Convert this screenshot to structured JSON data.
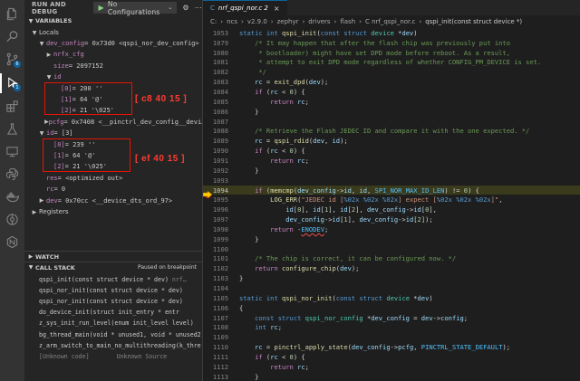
{
  "activity": {
    "icons": [
      "files-icon",
      "search-icon",
      "source-control-icon",
      "run-debug-icon",
      "extensions-icon",
      "testing-icon",
      "remote-explorer-icon",
      "python-icon",
      "docker-icon",
      "gitlens-icon",
      "nordic-icon"
    ],
    "run_badge": "1"
  },
  "sidebar": {
    "header": "RUN AND DEBUG",
    "config": "No Configurations",
    "variables_section": "VARIABLES",
    "locals_label": "Locals",
    "registers_label": "Registers",
    "watch_section": "WATCH",
    "callstack_section": "CALL STACK",
    "callstack_status": "Paused on breakpoint",
    "annotation_1": "[ c8 40 15 ]",
    "annotation_2": "[ ef 40 15 ]",
    "vars": [
      {
        "indent": 1,
        "twisty": "open",
        "name": "dev_config",
        "value": "= 0x73d0 <qspi_nor_dev_config>"
      },
      {
        "indent": 2,
        "twisty": "closed",
        "name": "nrfx_cfg",
        "value": ""
      },
      {
        "indent": 2,
        "twisty": "",
        "name": "size",
        "value": "= 2097152"
      },
      {
        "indent": 2,
        "twisty": "open",
        "name": "id",
        "value": ""
      },
      {
        "indent": 3,
        "twisty": "",
        "name": "[0]",
        "value": "= 200 ''"
      },
      {
        "indent": 3,
        "twisty": "",
        "name": "[1]",
        "value": "= 64 '@'"
      },
      {
        "indent": 3,
        "twisty": "",
        "name": "[2]",
        "value": "= 21 '\\025'"
      },
      {
        "indent": 2,
        "twisty": "closed",
        "name": "pcfg",
        "value": "= 0x7408 <__pinctrl_dev_config__devi…"
      },
      {
        "indent": 1,
        "twisty": "open",
        "name": "id",
        "value": "= [3]"
      },
      {
        "indent": 2,
        "twisty": "",
        "name": "[0]",
        "value": "= 239 ''"
      },
      {
        "indent": 2,
        "twisty": "",
        "name": "[1]",
        "value": "= 64 '@'"
      },
      {
        "indent": 2,
        "twisty": "",
        "name": "[2]",
        "value": "= 21 '\\025'"
      },
      {
        "indent": 1,
        "twisty": "",
        "name": "res",
        "value": "= <optimized out>"
      },
      {
        "indent": 1,
        "twisty": "",
        "name": "rc",
        "value": "= 0"
      },
      {
        "indent": 1,
        "twisty": "closed",
        "name": "dev",
        "value": "= 0x70cc <__device_dts_ord_97>"
      }
    ],
    "callstack": [
      {
        "fn": "qspi_init(const struct device * dev)",
        "src": "nrf…"
      },
      {
        "fn": "qspi_nor_init(const struct device * dev)",
        "src": ""
      },
      {
        "fn": "qspi_nor_init(const struct device * dev)",
        "src": ""
      },
      {
        "fn": "do_device_init(struct init_entry * entr",
        "src": ""
      },
      {
        "fn": "z_sys_init_run_level(enum init_level level)",
        "src": ""
      },
      {
        "fn": "bg_thread_main(void * unused1, void * unused2",
        "src": ""
      },
      {
        "fn": "z_arm_switch_to_main_no_multithreading(k_thre",
        "src": ""
      },
      {
        "fn": "[Unknown code]",
        "src": "Unknown Source"
      }
    ]
  },
  "editor": {
    "tab_label": "nrf_qspi_nor.c 2",
    "breadcrumbs": [
      "C:",
      "ncs",
      "v2.9.0",
      "zephyr",
      "drivers",
      "flash",
      "C  nrf_qspi_nor.c",
      "qspi_init(const struct device *)"
    ],
    "current_line": "1094",
    "lines": [
      {
        "n": "1053",
        "html": "<span class='kw'>static</span> <span class='kw'>int</span> <span class='fn'>qspi_init</span>(<span class='kw'>const</span> <span class='kw'>struct</span> <span class='ty'>device</span> *<span class='va'>dev</span>)"
      },
      {
        "n": "1079",
        "html": "    <span class='cm'>/* It may happen that after the flash chip was previously put into</span>"
      },
      {
        "n": "1080",
        "html": "    <span class='cm'> * bootloader) might have set DPD mode before reboot. As a result,</span>"
      },
      {
        "n": "1081",
        "html": "    <span class='cm'> * attempt to exit DPD mode regardless of whether CONFIG_PM_DEVICE is set.</span>"
      },
      {
        "n": "1082",
        "html": "    <span class='cm'> */</span>"
      },
      {
        "n": "1083",
        "html": "    <span class='va'>rc</span> = <span class='fn'>exit_dpd</span>(<span class='va'>dev</span>);"
      },
      {
        "n": "1084",
        "html": "    <span class='kw2'>if</span> (<span class='va'>rc</span> &lt; <span class='nu'>0</span>) {"
      },
      {
        "n": "1085",
        "html": "        <span class='kw2'>return</span> <span class='va'>rc</span>;"
      },
      {
        "n": "1086",
        "html": "    }"
      },
      {
        "n": "1087",
        "html": ""
      },
      {
        "n": "1088",
        "html": "    <span class='cm'>/* Retrieve the Flash JEDEC ID and compare it with the one expected. */</span>"
      },
      {
        "n": "1089",
        "html": "    <span class='va'>rc</span> = <span class='fn'>qspi_rdid</span>(<span class='va'>dev</span>, <span class='va'>id</span>);"
      },
      {
        "n": "1090",
        "html": "    <span class='kw2'>if</span> (<span class='va'>rc</span> &lt; <span class='nu'>0</span>) {"
      },
      {
        "n": "1091",
        "html": "        <span class='kw2'>return</span> <span class='va'>rc</span>;"
      },
      {
        "n": "1092",
        "html": "    }"
      },
      {
        "n": "1093",
        "html": ""
      },
      {
        "n": "1094",
        "html": "    <span class='kw2'>if</span> (<span class='fn'>memcmp</span>(<span class='va'>dev_config</span>-&gt;<span class='va'>id</span>, <span class='va'>id</span>, <span class='ma'>SPI_NOR_MAX_ID_LEN</span>) != <span class='nu'>0</span>) {"
      },
      {
        "n": "1095",
        "html": "        <span class='fn'>LOG_ERR</span>(<span class='st'>\"JEDEC id [</span><span class='fmt'>%02x %02x %02x</span><span class='st'>] expect [</span><span class='fmt'>%02x %02x %02x</span><span class='st'>]\"</span>,"
      },
      {
        "n": "1096",
        "html": "            <span class='va'>id</span>[<span class='nu'>0</span>], <span class='va'>id</span>[<span class='nu'>1</span>], <span class='va'>id</span>[<span class='nu'>2</span>], <span class='va'>dev_config</span>-&gt;<span class='va'>id</span>[<span class='nu'>0</span>],"
      },
      {
        "n": "1097",
        "html": "            <span class='va'>dev_config</span>-&gt;<span class='va'>id</span>[<span class='nu'>1</span>], <span class='va'>dev_config</span>-&gt;<span class='va'>id</span>[<span class='nu'>2</span>]);"
      },
      {
        "n": "1098",
        "html": "        <span class='kw2'>return</span> -<span class='err'>ENODEV</span>;"
      },
      {
        "n": "1099",
        "html": "    }"
      },
      {
        "n": "1100",
        "html": ""
      },
      {
        "n": "1101",
        "html": "    <span class='cm'>/* The chip is correct, it can be configured now. */</span>"
      },
      {
        "n": "1102",
        "html": "    <span class='kw2'>return</span> <span class='fn'>configure_chip</span>(<span class='va'>dev</span>);"
      },
      {
        "n": "1103",
        "html": "}"
      },
      {
        "n": "1104",
        "html": ""
      },
      {
        "n": "1105",
        "html": "<span class='kw'>static</span> <span class='kw'>int</span> <span class='fn'>qspi_nor_init</span>(<span class='kw'>const</span> <span class='kw'>struct</span> <span class='ty'>device</span> *<span class='va'>dev</span>)"
      },
      {
        "n": "1106",
        "html": "{"
      },
      {
        "n": "1107",
        "html": "    <span class='kw'>const</span> <span class='kw'>struct</span> <span class='ty'>qspi_nor_config</span> *<span class='va'>dev_config</span> = <span class='va'>dev</span>-&gt;<span class='va'>config</span>;"
      },
      {
        "n": "1108",
        "html": "    <span class='kw'>int</span> <span class='va'>rc</span>;"
      },
      {
        "n": "1109",
        "html": ""
      },
      {
        "n": "1110",
        "html": "    <span class='va'>rc</span> = <span class='fn'>pinctrl_apply_state</span>(<span class='va'>dev_config</span>-&gt;<span class='va'>pcfg</span>, <span class='ma'>PINCTRL_STATE_DEFAULT</span>);"
      },
      {
        "n": "1111",
        "html": "    <span class='kw2'>if</span> (<span class='va'>rc</span> &lt; <span class='nu'>0</span>) {"
      },
      {
        "n": "1112",
        "html": "        <span class='kw2'>return</span> <span class='va'>rc</span>;"
      },
      {
        "n": "1113",
        "html": "    }"
      }
    ]
  }
}
